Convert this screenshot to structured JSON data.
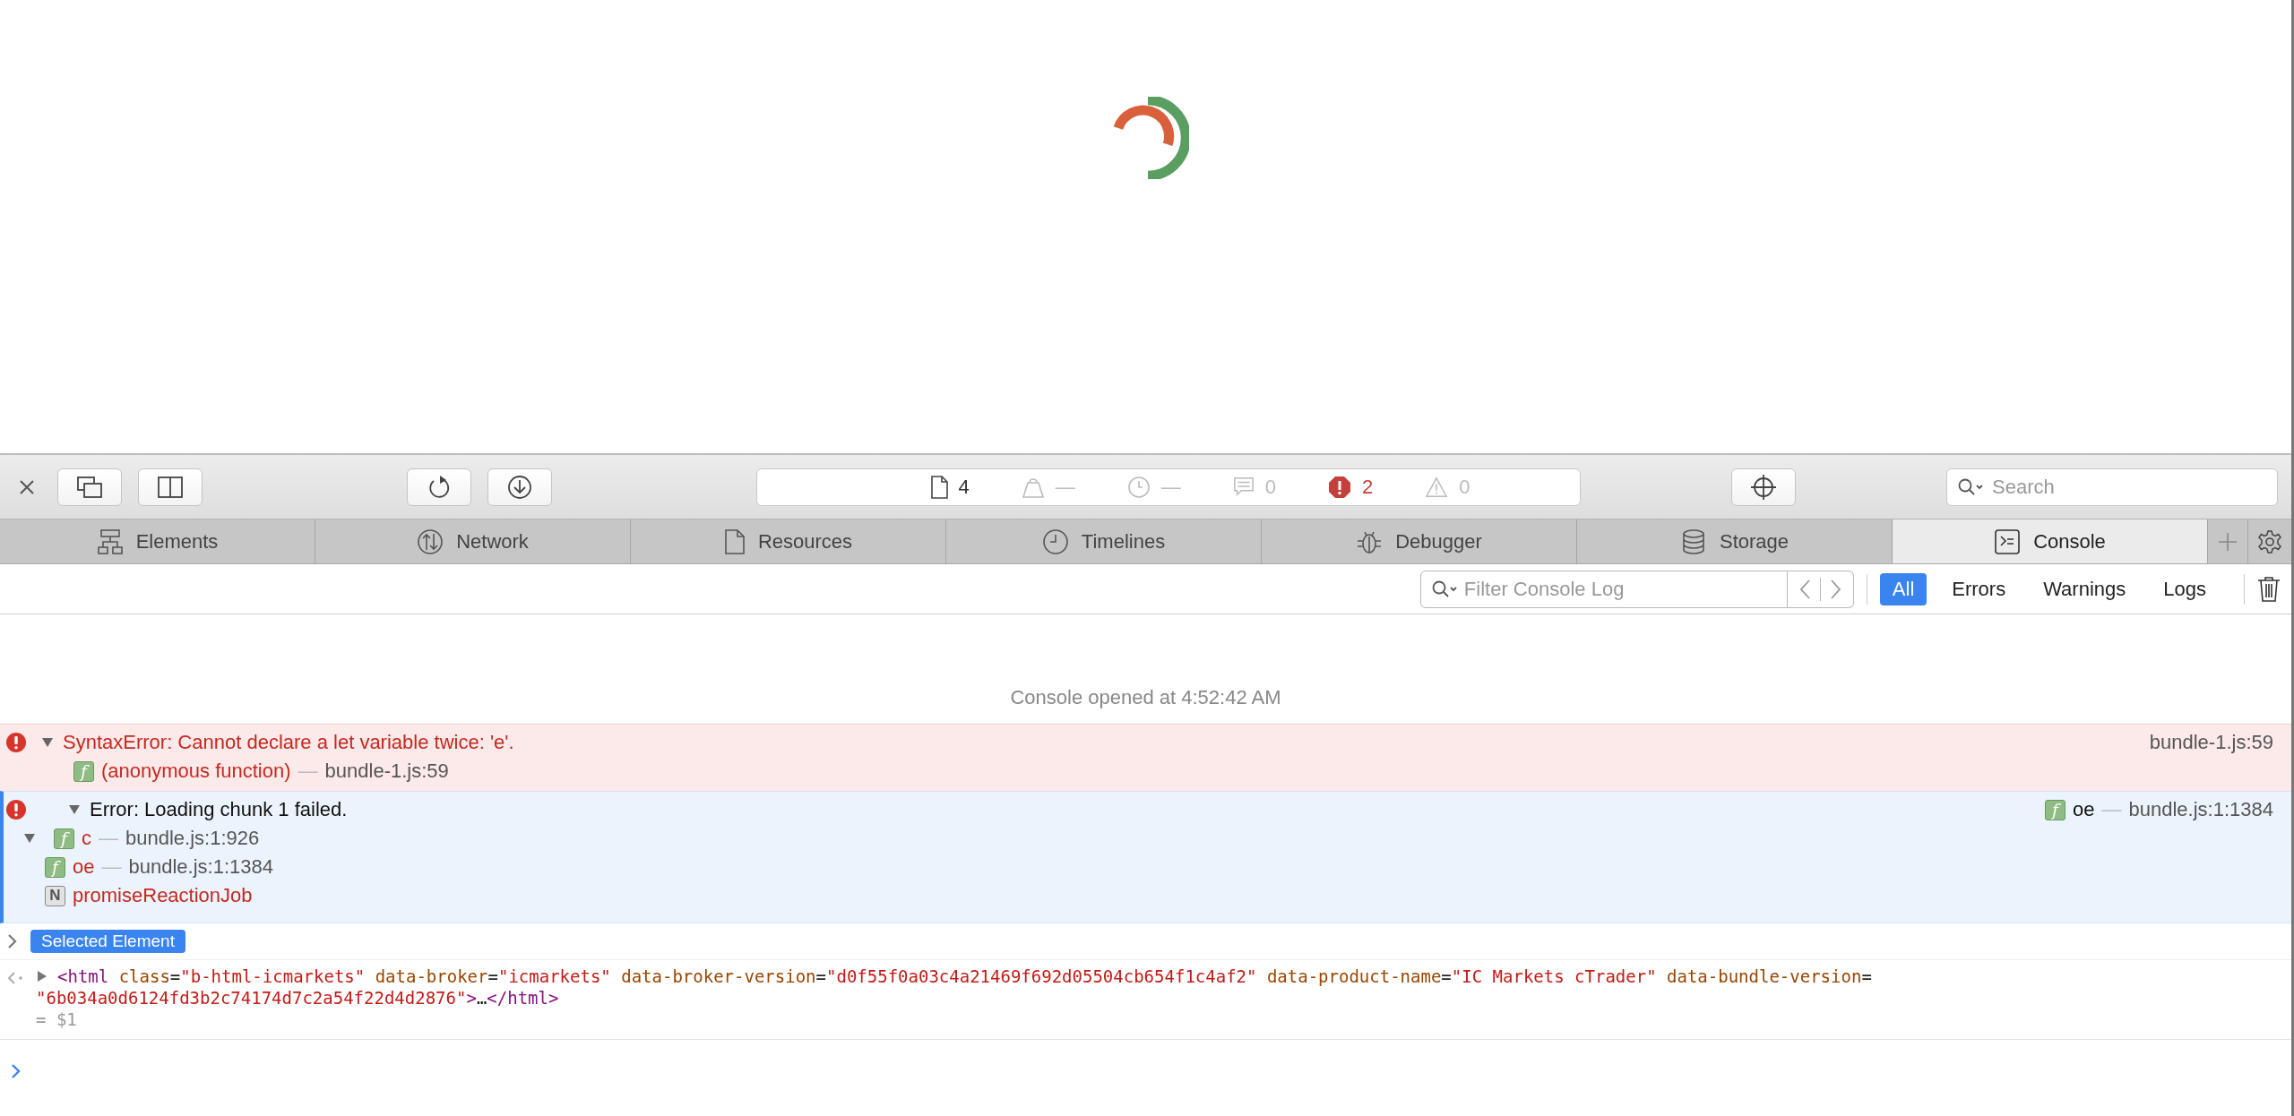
{
  "dashboard": [
    {
      "kind": "resources",
      "value": "4"
    },
    {
      "kind": "network",
      "value": "—"
    },
    {
      "kind": "time",
      "value": "—"
    },
    {
      "kind": "logs",
      "value": "0"
    },
    {
      "kind": "errors",
      "value": "2"
    },
    {
      "kind": "warnings",
      "value": "0"
    }
  ],
  "search": {
    "placeholder": "Search"
  },
  "tabs": [
    {
      "kind": "elements",
      "label": "Elements",
      "selected": false
    },
    {
      "kind": "network",
      "label": "Network",
      "selected": false
    },
    {
      "kind": "resources",
      "label": "Resources",
      "selected": false
    },
    {
      "kind": "timelines",
      "label": "Timelines",
      "selected": false
    },
    {
      "kind": "debugger",
      "label": "Debugger",
      "selected": false
    },
    {
      "kind": "storage",
      "label": "Storage",
      "selected": false
    },
    {
      "kind": "console",
      "label": "Console",
      "selected": true
    }
  ],
  "filter": {
    "placeholder": "Filter Console Log",
    "scopes": [
      {
        "label": "All",
        "selected": true
      },
      {
        "label": "Errors",
        "selected": false
      },
      {
        "label": "Warnings",
        "selected": false
      },
      {
        "label": "Logs",
        "selected": false
      }
    ]
  },
  "console": {
    "opened_note": "Console opened at 4:52:42 AM",
    "messages": [
      {
        "kind": "error",
        "selected": false,
        "expanded": true,
        "text": "SyntaxError: Cannot declare a let variable twice: 'e'.",
        "source": {
          "location": "bundle-1.js:59"
        },
        "frames": [
          {
            "kind": "function",
            "badge": "f",
            "name": "(anonymous function)",
            "separator": "—",
            "location": "bundle-1.js:59"
          }
        ]
      },
      {
        "kind": "error",
        "selected": true,
        "expanded": true,
        "text": "Error: Loading chunk 1 failed.",
        "source": {
          "badge": "f",
          "name": "oe",
          "separator": "—",
          "location": "bundle.js:1:1384"
        },
        "stack_group": {
          "expanded": true,
          "frames": [
            {
              "kind": "function",
              "badge": "f",
              "name": "c",
              "separator": "—",
              "location": "bundle.js:1:926"
            }
          ]
        },
        "frames": [
          {
            "kind": "function",
            "badge": "f",
            "name": "oe",
            "separator": "—",
            "location": "bundle.js:1:1384"
          },
          {
            "kind": "native",
            "badge": "N",
            "name": "promiseReactionJob"
          }
        ]
      }
    ],
    "selected_element": {
      "expanded": false,
      "label": "Selected Element"
    },
    "result": {
      "expanded": false,
      "lines": [
        [
          {
            "kind": "tag",
            "text": "<html"
          },
          {
            "kind": "attr",
            "text": " class"
          },
          {
            "kind": "punct",
            "text": "="
          },
          {
            "kind": "value",
            "text": "\"b-html-icmarkets\""
          },
          {
            "kind": "attr",
            "text": " data-broker"
          },
          {
            "kind": "punct",
            "text": "="
          },
          {
            "kind": "value",
            "text": "\"icmarkets\""
          },
          {
            "kind": "attr",
            "text": " data-broker-version"
          },
          {
            "kind": "punct",
            "text": "="
          },
          {
            "kind": "value",
            "text": "\"d0f55f0a03c4a21469f692d05504cb654f1c4af2\""
          },
          {
            "kind": "attr",
            "text": " data-product-name"
          },
          {
            "kind": "punct",
            "text": "="
          },
          {
            "kind": "value",
            "text": "\"IC Markets cTrader\""
          },
          {
            "kind": "attr",
            "text": " data-bundle-version"
          },
          {
            "kind": "punct",
            "text": "="
          }
        ],
        [
          {
            "kind": "value",
            "text": "\"6b034a0d6124fd3b2c74174d7c2a54f22d4d2876\""
          },
          {
            "kind": "tag",
            "text": ">"
          },
          {
            "kind": "punct",
            "text": "…"
          },
          {
            "kind": "tag",
            "text": "</html>"
          }
        ]
      ],
      "saved_as": "= $1"
    }
  }
}
